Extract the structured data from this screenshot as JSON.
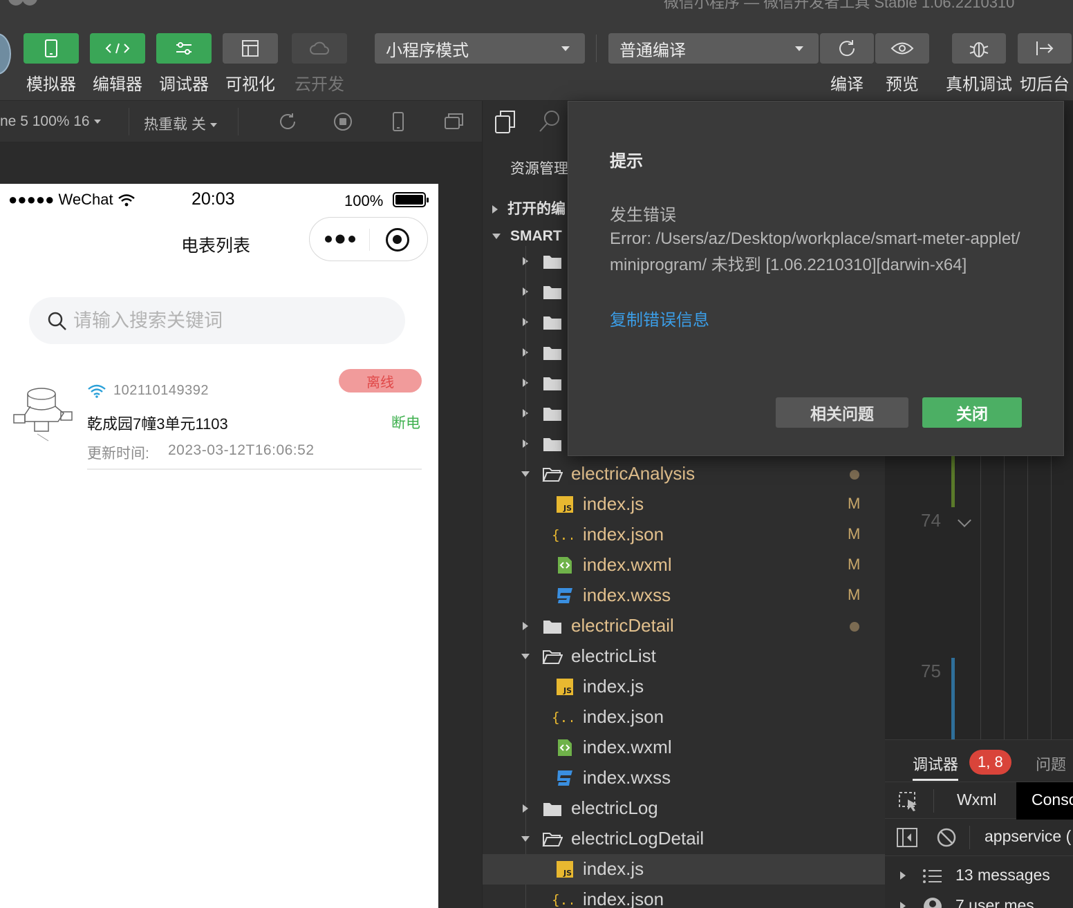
{
  "window": {
    "title": "微信小程序 — 微信开发者工具 Stable 1.06.2210310"
  },
  "toolbar": {
    "left_tools": [
      {
        "label": "模拟器",
        "icon": "phone-icon",
        "state": "active"
      },
      {
        "label": "编辑器",
        "icon": "code-icon",
        "state": "active"
      },
      {
        "label": "调试器",
        "icon": "sliders-icon",
        "state": "active"
      },
      {
        "label": "可视化",
        "icon": "layout-icon",
        "state": "inactive"
      },
      {
        "label": "云开发",
        "icon": "cloud-icon",
        "state": "disabled"
      }
    ],
    "mode_select": "小程序模式",
    "compile_select": "普通编译",
    "right_tools": [
      {
        "label": "编译",
        "icon": "refresh-icon"
      },
      {
        "label": "预览",
        "icon": "eye-icon"
      },
      {
        "label": "真机调试",
        "icon": "bug-icon"
      },
      {
        "label": "切后台",
        "icon": "switch-background-icon"
      }
    ]
  },
  "simbar": {
    "device": "ne 5 100% 16",
    "hot_reload": "热重载 关"
  },
  "phone": {
    "status": {
      "signal": "●●●●● WeChat",
      "time": "20:03",
      "battery": "100%"
    },
    "nav_title": "电表列表",
    "search_placeholder": "请输入搜索关键词",
    "meters": [
      {
        "id": "102110149392",
        "status": "离线",
        "address": "乾成园7幢3单元1103",
        "power": "断电",
        "time_label": "更新时间:",
        "time": "2023-03-12T16:06:52"
      }
    ]
  },
  "explorer": {
    "title": "资源管理",
    "open_editors": "打开的编",
    "project": "SMART",
    "tree": [
      {
        "type": "folder",
        "name": "electricAnalysis",
        "open": true,
        "modified": true
      },
      {
        "type": "js",
        "name": "index.js",
        "status": "M"
      },
      {
        "type": "json",
        "name": "index.json",
        "status": "M"
      },
      {
        "type": "wxml",
        "name": "index.wxml",
        "status": "M"
      },
      {
        "type": "wxss",
        "name": "index.wxss",
        "status": "M"
      },
      {
        "type": "folder",
        "name": "electricDetail",
        "open": false,
        "modified": true
      },
      {
        "type": "folder",
        "name": "electricList",
        "open": true,
        "modified": false
      },
      {
        "type": "js",
        "name": "index.js",
        "status": ""
      },
      {
        "type": "json",
        "name": "index.json",
        "status": ""
      },
      {
        "type": "wxml",
        "name": "index.wxml",
        "status": ""
      },
      {
        "type": "wxss",
        "name": "index.wxss",
        "status": ""
      },
      {
        "type": "folder",
        "name": "electricLog",
        "open": false,
        "modified": false
      },
      {
        "type": "folder",
        "name": "electricLogDetail",
        "open": true,
        "modified": false
      },
      {
        "type": "js",
        "name": "index.js",
        "status": "",
        "selected": true
      },
      {
        "type": "json",
        "name": "index.json",
        "status": ""
      }
    ]
  },
  "editor": {
    "line_numbers": [
      "74",
      "75"
    ]
  },
  "debugger": {
    "tab_label": "调试器",
    "badge": "1, 8",
    "problems_tab": "问题",
    "wxml_tab": "Wxml",
    "console_tab": "Conso",
    "context": "appservice (",
    "messages": "13 messages",
    "user_messages": "7 user mes"
  },
  "modal": {
    "title": "提示",
    "subtitle": "发生错误",
    "body": "Error: /Users/az/Desktop/workplace/smart-meter-applet/miniprogram/ 未找到 [1.06.2210310][darwin-x64]",
    "link": "复制错误信息",
    "related_button": "相关问题",
    "close_button": "关闭"
  },
  "colors": {
    "accent_green": "#3aa657",
    "link_blue": "#3b9ee8",
    "offline_red": "#e04848",
    "power_green": "#3fb04f",
    "modified_yellow": "#e2c08d"
  }
}
